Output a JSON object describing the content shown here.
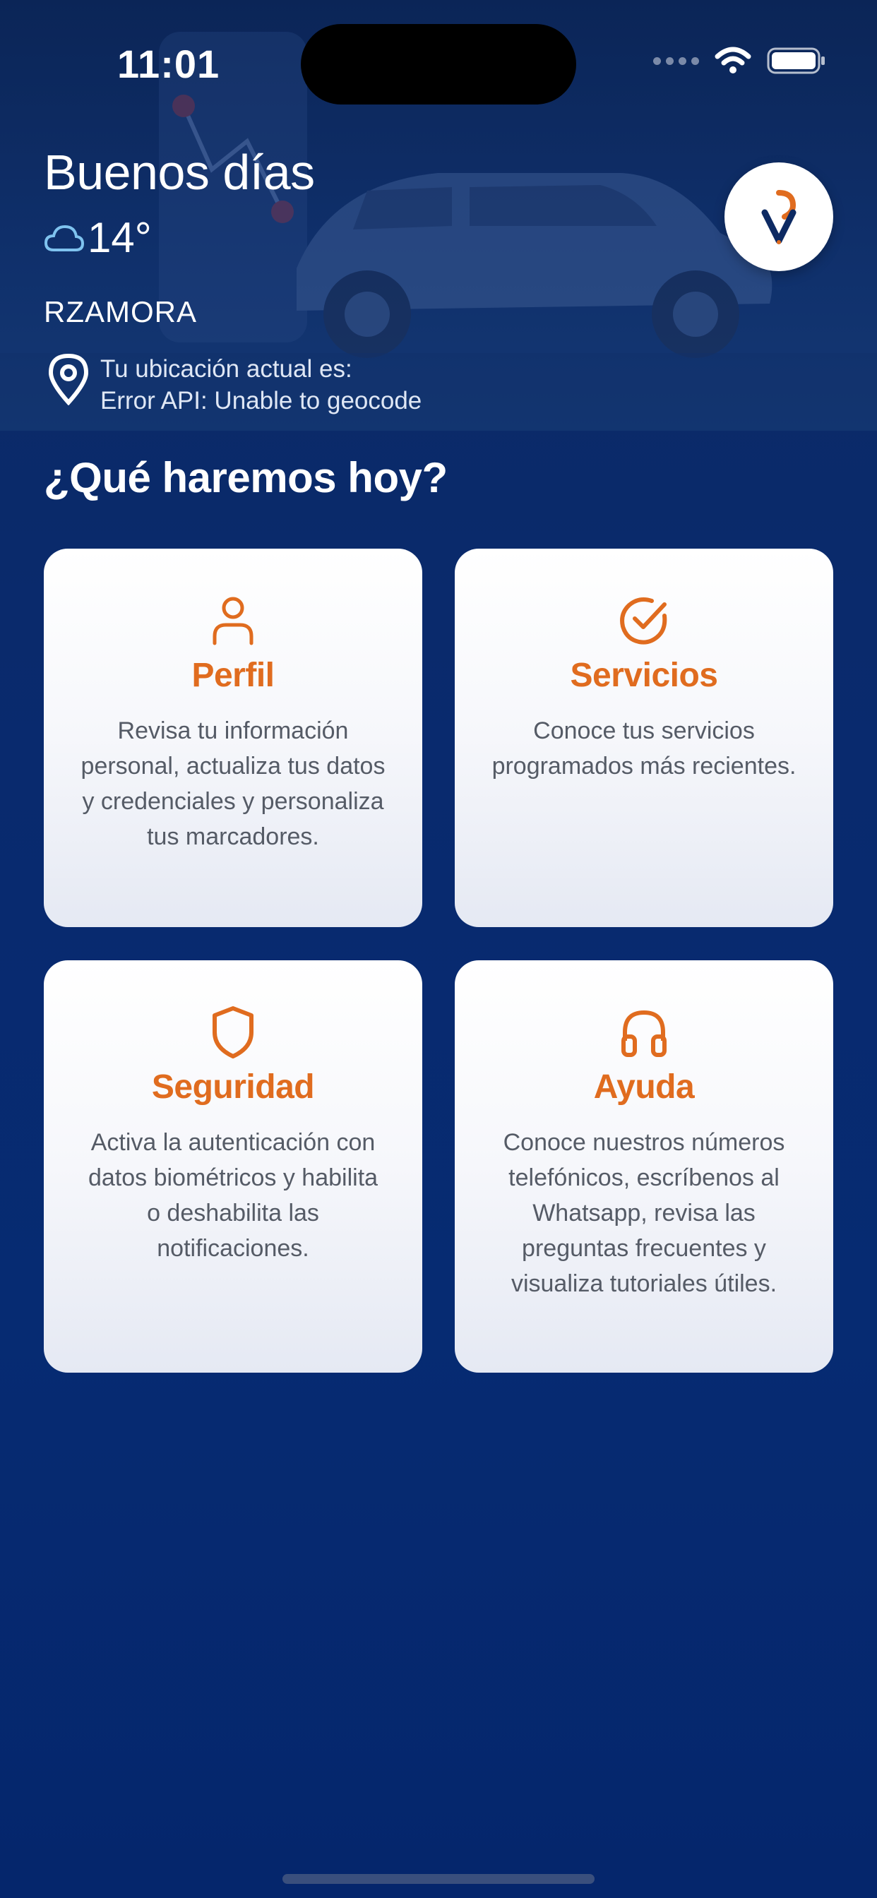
{
  "status_bar": {
    "time": "11:01"
  },
  "header": {
    "greeting": "Buenos días",
    "temperature": "14°",
    "weather_icon": "cloud-icon",
    "username": "RZAMORA",
    "location_label": "Tu ubicación actual es:",
    "location_value": "Error API: Unable to geocode"
  },
  "section_title": "¿Qué haremos hoy?",
  "cards": [
    {
      "icon": "user-icon",
      "title": "Perfil",
      "description": "Revisa tu información personal, actualiza tus datos y credenciales y personaliza tus marcadores."
    },
    {
      "icon": "check-circle-icon",
      "title": "Servicios",
      "description": "Conoce tus servicios programados más recientes."
    },
    {
      "icon": "shield-icon",
      "title": "Seguridad",
      "description": "Activa la autenticación con datos biométricos y habilita o deshabilita las notificaciones."
    },
    {
      "icon": "headphones-icon",
      "title": "Ayuda",
      "description": "Conoce nuestros números telefónicos, escríbenos al Whatsapp, revisa las preguntas frecuentes y visualiza tutoriales útiles."
    }
  ],
  "colors": {
    "accent": "#e06c1f",
    "background": "#062b72",
    "card_text": "#555b66"
  }
}
